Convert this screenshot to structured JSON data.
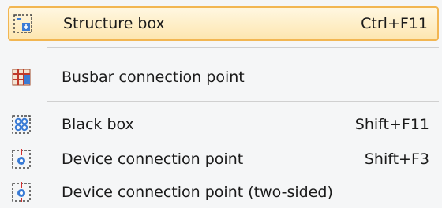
{
  "menu": {
    "items": [
      {
        "label": "Structure box",
        "shortcut": "Ctrl+F11",
        "icon": "structure-box-icon",
        "highlighted": true
      },
      {
        "label": "Busbar connection point",
        "shortcut": "",
        "icon": "busbar-connection-point-icon"
      },
      {
        "label": "Black box",
        "shortcut": "Shift+F11",
        "icon": "black-box-icon"
      },
      {
        "label": "Device connection point",
        "shortcut": "Shift+F3",
        "icon": "device-connection-point-icon"
      },
      {
        "label": "Device connection point (two-sided)",
        "shortcut": "",
        "icon": "device-connection-point-two-sided-icon"
      }
    ]
  },
  "colors": {
    "highlight_border": "#f2b652",
    "highlight_fill": "#fde6b0",
    "menu_background": "#f5f6f7"
  }
}
